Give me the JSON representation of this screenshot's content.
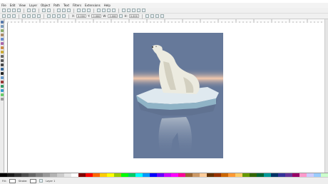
{
  "menu": {
    "items": [
      "File",
      "Edit",
      "View",
      "Layer",
      "Object",
      "Path",
      "Text",
      "Filters",
      "Extensions",
      "Help"
    ]
  },
  "controls": {
    "x_label": "X:",
    "x_value": "0.000",
    "y_label": "Y:",
    "y_value": "0.000",
    "w_label": "W:",
    "w_value": "0.000",
    "h_label": "H:",
    "h_value": "0.000"
  },
  "status": {
    "fill_label": "Fill:",
    "stroke_label": "Stroke:",
    "layer": "Layer 1"
  },
  "colors": {
    "page_bg": "#66799a",
    "glow": "#f3c9ad",
    "ice": "#dfe9ef",
    "bear": "#ecebe0"
  },
  "palette": [
    "#000000",
    "#1a1a1a",
    "#333333",
    "#4d4d4d",
    "#666666",
    "#808080",
    "#999999",
    "#b3b3b3",
    "#cccccc",
    "#e6e6e6",
    "#ffffff",
    "#800000",
    "#ff0000",
    "#ff6600",
    "#ffcc00",
    "#ffff00",
    "#99cc00",
    "#00ff00",
    "#00cc66",
    "#00ffff",
    "#0099ff",
    "#0000ff",
    "#6600ff",
    "#cc00ff",
    "#ff00ff",
    "#ff0099",
    "#996633",
    "#cc9966",
    "#ffcc99",
    "#663300",
    "#993300",
    "#cc6600",
    "#ff9933",
    "#ffcc66",
    "#669900",
    "#336600",
    "#006633",
    "#009999",
    "#003366",
    "#333399",
    "#663399",
    "#990066",
    "#ff99cc",
    "#ccccff",
    "#99ccff",
    "#ccffcc"
  ]
}
